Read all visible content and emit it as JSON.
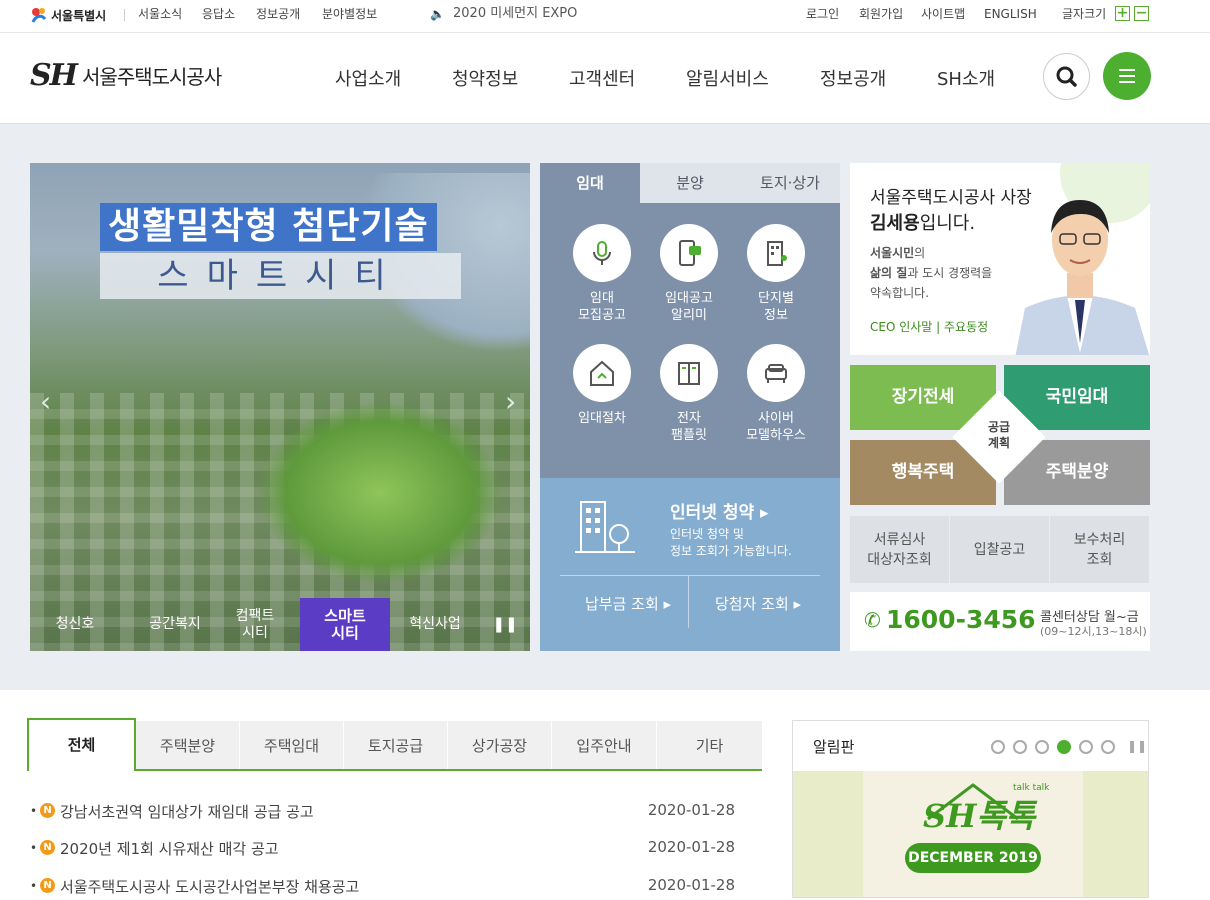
{
  "topbar": {
    "seoul_logo": "서울특별시",
    "links": [
      "서울소식",
      "응답소",
      "정보공개",
      "분야별정보"
    ],
    "expo": "2020 미세먼지 EXPO",
    "util": [
      "로그인",
      "회원가입",
      "사이트맵",
      "ENGLISH"
    ],
    "font_size_label": "글자크기",
    "font_plus": "+",
    "font_minus": "−"
  },
  "header": {
    "logo_mark": "SH",
    "logo_name": "서울주택도시공사",
    "gnb": [
      "사업소개",
      "청약정보",
      "고객센터",
      "알림서비스",
      "정보공개",
      "SH소개"
    ]
  },
  "slider": {
    "title_line1": "생활밀착형 첨단기술",
    "title_line2": "스마트시티",
    "nav": [
      "청신호",
      "공간복지",
      "컴팩트\n시티",
      "스마트\n시티",
      "혁신사업"
    ],
    "active_index": 3,
    "pause": "❚❚",
    "prev": "‹",
    "next": "›"
  },
  "housing": {
    "tabs": [
      "임대",
      "분양",
      "토지·상가"
    ],
    "services": [
      {
        "label": "임대\n모집공고",
        "icon": "microphone-icon"
      },
      {
        "label": "임대공고\n알리미",
        "icon": "phone-message-icon"
      },
      {
        "label": "단지별\n정보",
        "icon": "building-icon"
      },
      {
        "label": "임대절차",
        "icon": "house-document-icon"
      },
      {
        "label": "전자\n팸플릿",
        "icon": "book-icon"
      },
      {
        "label": "사이버\n모델하우스",
        "icon": "sofa-icon"
      }
    ],
    "internet_title": "인터넷 청약 ▸",
    "internet_desc": "인터넷 청약 및\n정보 조회가 가능합니다.",
    "query1": "납부금 조회 ▸",
    "query2": "당첨자 조회 ▸"
  },
  "ceo": {
    "line1": "서울주택도시공사 사장",
    "name": "김세용",
    "line2_suffix": "입니다.",
    "desc_bold1": "서울시민",
    "desc1": "의",
    "desc_bold2": "삶의 질",
    "desc2": "과 도시 경쟁력을",
    "desc3": "약속합니다.",
    "links": "CEO 인사말 | 주요동정"
  },
  "supply": {
    "tiles": [
      "장기전세",
      "국민임대",
      "행복주택",
      "주택분양"
    ],
    "colors": [
      "#7cbc50",
      "#2f9c72",
      "#a38a62",
      "#9a9a9a"
    ],
    "center": "공급\n계획"
  },
  "small_buttons": [
    "서류심사\n대상자조회",
    "입찰공고",
    "보수처리\n조회"
  ],
  "callcenter": {
    "number": "1600-3456",
    "label": "콜센터상담 월~금",
    "hours": "(09~12시,13~18시)"
  },
  "notice": {
    "tabs": [
      "전체",
      "주택분양",
      "주택임대",
      "토지공급",
      "상가공장",
      "입주안내",
      "기타"
    ],
    "new_badge": "N",
    "rows": [
      {
        "title": "강남서초권역 임대상가 재임대 공급 공고",
        "date": "2020-01-28"
      },
      {
        "title": "2020년 제1회 시유재산 매각 공고",
        "date": "2020-01-28"
      },
      {
        "title": "서울주택도시공사 도시공간사업본부장 채용공고",
        "date": "2020-01-28"
      }
    ]
  },
  "board": {
    "title": "알림판",
    "active_dot": 3,
    "pause": "❚❚",
    "banner_logo": "SH톡톡",
    "banner_sub": "talk talk",
    "banner_month": "DECEMBER 2019"
  }
}
